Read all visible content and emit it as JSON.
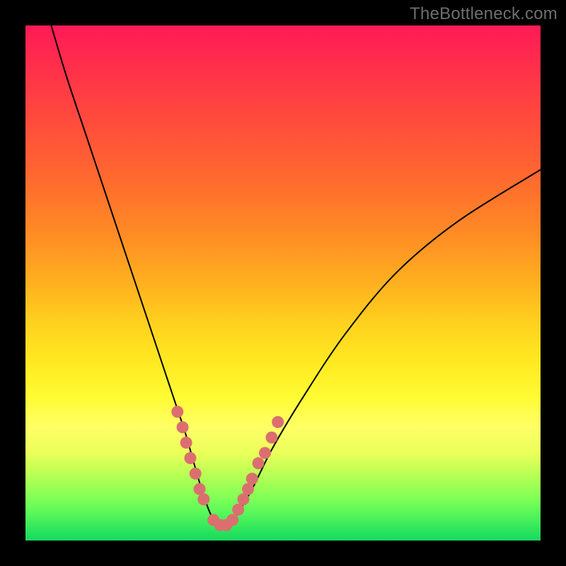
{
  "watermark": "TheBottleneck.com",
  "chart_data": {
    "type": "line",
    "title": "",
    "xlabel": "",
    "ylabel": "",
    "xlim": [
      0,
      100
    ],
    "ylim": [
      0,
      100
    ],
    "series": [
      {
        "name": "bottleneck-curve",
        "x": [
          5,
          8,
          12,
          16,
          20,
          24,
          27,
          29,
          31,
          33,
          34.5,
          36,
          37.5,
          39,
          41,
          44,
          48,
          54,
          62,
          72,
          84,
          100
        ],
        "y": [
          100,
          90,
          78,
          66,
          54,
          42,
          33,
          27,
          21,
          14,
          9,
          5,
          3,
          3,
          5,
          10,
          18,
          28,
          40,
          52,
          62,
          72
        ]
      }
    ],
    "markers": {
      "name": "highlight-beads",
      "x": [
        29.5,
        30.5,
        31.2,
        32.0,
        33.0,
        33.8,
        34.6,
        36.5,
        37.8,
        39.0,
        40.2,
        41.3,
        42.3,
        43.2,
        44.0,
        45.2,
        46.5,
        47.8,
        49.0
      ],
      "y": [
        25,
        22,
        19,
        16,
        13,
        10,
        8,
        4,
        3,
        3,
        4,
        6,
        8,
        10,
        12,
        15,
        17,
        20,
        23
      ]
    },
    "gradient_stops": [
      {
        "pos": 0,
        "color": "#ff1a56"
      },
      {
        "pos": 50,
        "color": "#ffb01f"
      },
      {
        "pos": 75,
        "color": "#ffff55"
      },
      {
        "pos": 100,
        "color": "#18d85f"
      }
    ]
  }
}
